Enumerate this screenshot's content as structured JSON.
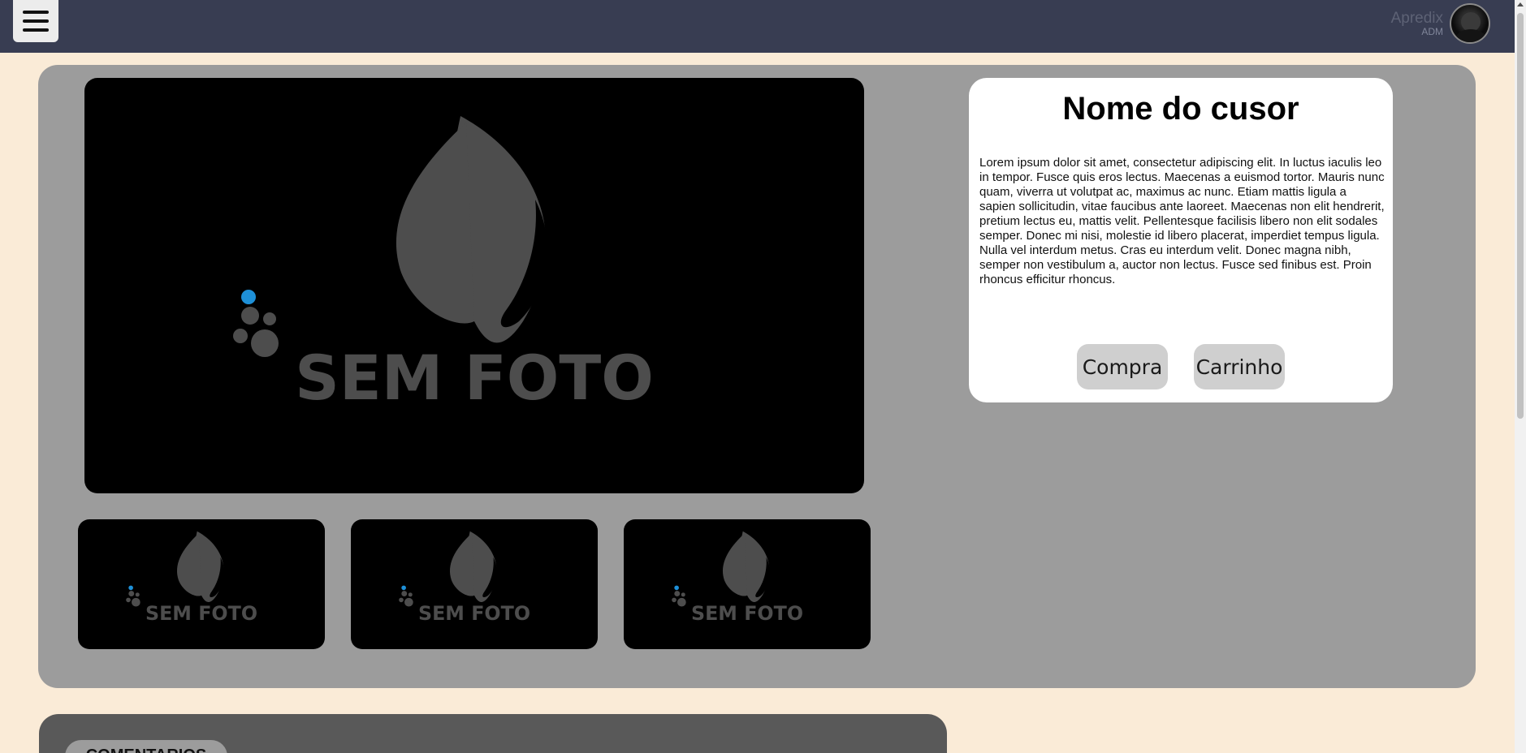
{
  "header": {
    "user_name": "Apredix",
    "user_role": "ADM"
  },
  "product": {
    "placeholder_text": "SEM FOTO",
    "title": "Nome do cusor",
    "description": "Lorem ipsum dolor sit amet, consectetur adipiscing elit. In luctus iaculis leo in tempor. Fusce quis eros lectus. Maecenas a euismod tortor. Mauris nunc quam, viverra ut volutpat ac, maximus ac nunc. Etiam mattis ligula a sapien sollicitudin, vitae faucibus ante laoreet. Maecenas non elit hendrerit, pretium lectus eu, mattis velit. Pellentesque facilisis libero non elit sodales semper. Donec mi nisi, molestie id libero placerat, imperdiet tempus ligula. Nulla vel interdum metus. Cras eu interdum velit. Donec magna nibh, semper non vestibulum a, auctor non lectus. Fusce sed finibus est. Proin rhoncus efficitur rhoncus.",
    "buy_label": "Compra",
    "cart_label": "Carrinho"
  },
  "comments": {
    "tab_label": "comentarios"
  },
  "icons": {
    "menu": "hamburger-icon",
    "avatar": "user-avatar",
    "placeholder_logo": "flame-logo-icon"
  },
  "colors": {
    "topbar": "#383d52",
    "page_bg": "#faebd7",
    "panel_bg": "#9c9c9c",
    "comments_bg": "#595959",
    "logo_gray": "#4d4d4d",
    "logo_accent": "#1e90d8"
  }
}
